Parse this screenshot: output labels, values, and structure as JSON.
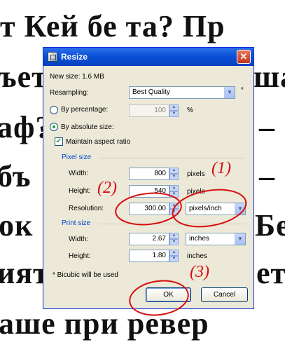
{
  "background": {
    "lines": [
      "т Кей бе    та? Пр",
      "ъет",
      "ша",
      "аф?",
      "–",
      "бъ",
      "–",
      "ок",
      "Бе",
      "ият",
      "ет",
      "аше при   ревер"
    ]
  },
  "dialog": {
    "title": "Resize",
    "close_symbol": "✕",
    "new_size": "New size: 1.6 MB",
    "resampling_label": "Resampling:",
    "resampling_value": "Best Quality",
    "asterisk": "*",
    "by_percentage_label": "By percentage:",
    "percentage_value": "100",
    "percent_sign": "%",
    "by_absolute_label": "By absolute size:",
    "maintain_aspect_label": "Maintain aspect ratio",
    "pixel_size_group": "Pixel size",
    "width_label": "Width:",
    "width_value": "800",
    "width_unit": "pixels",
    "height_label": "Height:",
    "height_value": "540",
    "height_unit": "pixels",
    "resolution_label": "Resolution:",
    "resolution_value": "300.00",
    "resolution_unit": "pixels/inch",
    "print_size_group": "Print size",
    "print_width_label": "Width:",
    "print_width_value": "2.67",
    "print_width_unit": "inches",
    "print_height_label": "Height:",
    "print_height_value": "1.80",
    "print_height_unit": "inches",
    "bicubic_note": "* Bicubic will be used",
    "ok_label": "OK",
    "cancel_label": "Cancel"
  },
  "annotations": [
    "(1)",
    "(2)",
    "(3)"
  ],
  "colors": {
    "annotation_red": "#d80e0e",
    "titlebar_blue": "#0a4fd6",
    "dialog_bg": "#ece9d8"
  }
}
